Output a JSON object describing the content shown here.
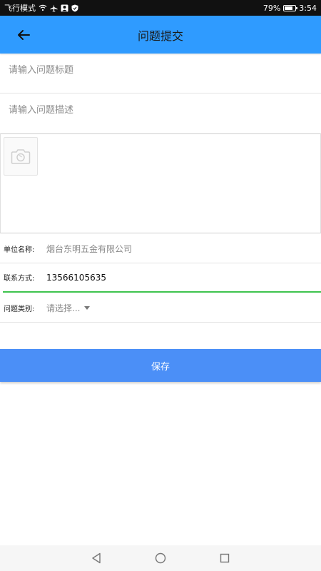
{
  "status_bar": {
    "mode_text": "飞行模式",
    "battery": "79%",
    "battery_level": 0.79,
    "time": "3:54",
    "icons": [
      "wifi-icon",
      "airplane-icon",
      "profile-icon",
      "shield-icon"
    ]
  },
  "app_bar": {
    "title": "问题提交",
    "back_icon": "back-arrow-icon",
    "color": "#2f9bff"
  },
  "form": {
    "title_placeholder": "请输入问题标题",
    "desc_placeholder": "请输入问题描述",
    "photo_icon": "camera-icon",
    "company_label": "单位名称:",
    "company_value": "烟台东明五金有限公司",
    "contact_label": "联系方式:",
    "contact_value": "13566105635",
    "category_label": "问题类别:",
    "category_value": "请选择..."
  },
  "save_button": {
    "label": "保存",
    "color": "#4b8ff7"
  },
  "nav": {
    "icons": [
      "back-triangle-icon",
      "home-circle-icon",
      "recents-square-icon"
    ]
  }
}
